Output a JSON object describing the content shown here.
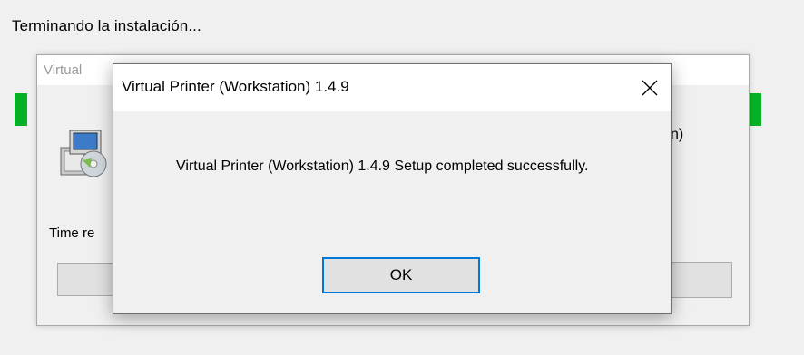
{
  "installer": {
    "status_text": "Terminando la instalación...",
    "progress_color": "#06b025"
  },
  "background_window": {
    "title": "Virtual",
    "right_partial_text": "n)",
    "time_label": "Time re",
    "right_button_partial": "l",
    "icon": "installer-package-icon"
  },
  "dialog": {
    "title": "Virtual Printer (Workstation) 1.4.9",
    "close_icon": "close-icon",
    "message": "Virtual Printer (Workstation) 1.4.9 Setup completed successfully.",
    "ok_label": "OK",
    "accent_color": "#0078d7"
  }
}
